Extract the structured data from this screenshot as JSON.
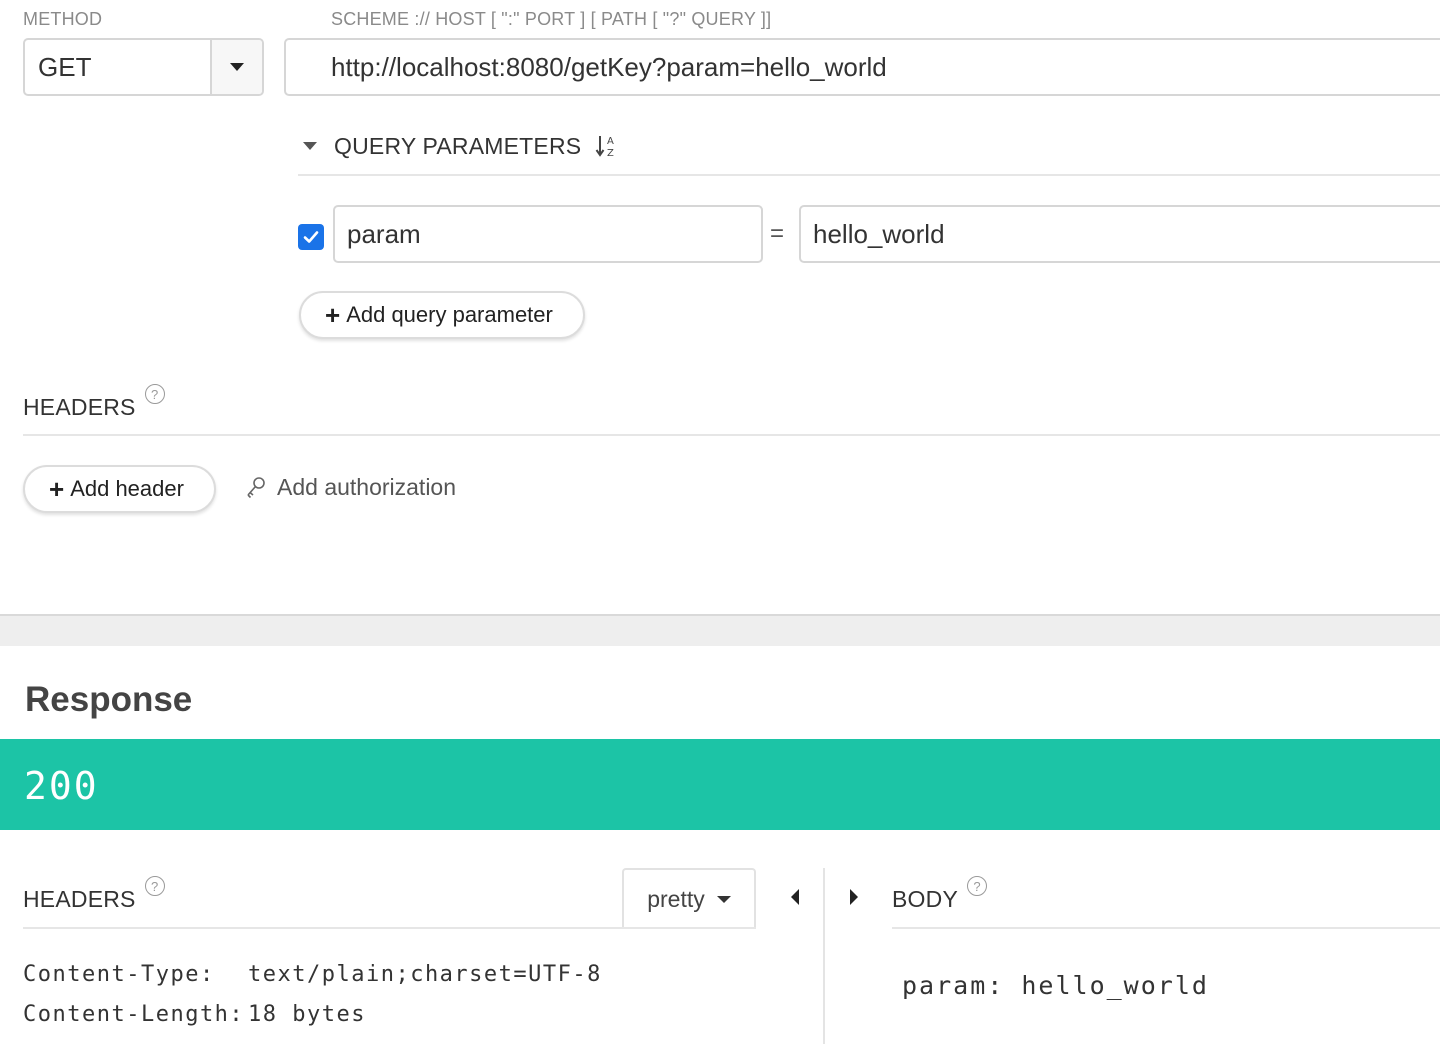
{
  "request": {
    "method_label": "METHOD",
    "method_value": "GET",
    "url_label": "SCHEME :// HOST [ \":\" PORT ] [ PATH [ \"?\" QUERY ]]",
    "url_value": "http://localhost:8080/getKey?param=hello_world",
    "query_params": {
      "title": "QUERY PARAMETERS",
      "items": [
        {
          "enabled": true,
          "name": "param",
          "separator": "=",
          "value": "hello_world"
        }
      ],
      "add_label": "Add query parameter"
    },
    "headers": {
      "title": "HEADERS",
      "help": "?",
      "add_label": "Add header",
      "auth_label": "Add authorization"
    }
  },
  "response": {
    "title": "Response",
    "status_code": "200",
    "status_color": "#1cc4a6",
    "headers": {
      "title": "HEADERS",
      "help": "?",
      "format": "pretty",
      "items": [
        {
          "name": "Content-Type:",
          "value": "text/plain;charset=UTF-8"
        },
        {
          "name": "Content-Length:",
          "value": "18 bytes"
        }
      ]
    },
    "body": {
      "title": "BODY",
      "help": "?",
      "content": "param: hello_world"
    }
  },
  "icons": {
    "method_dropdown": "caret-down-icon",
    "qp_toggle": "caret-down-icon",
    "sort": "sort-alpha-icon",
    "help": "question-circle-icon",
    "auth": "key-icon",
    "collapse_left": "caret-left-icon",
    "expand_right": "caret-right-icon"
  }
}
